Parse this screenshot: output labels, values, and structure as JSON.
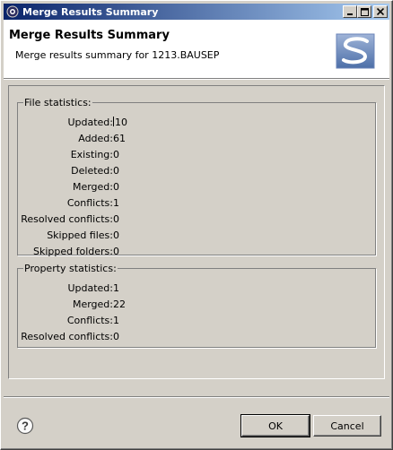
{
  "window": {
    "title": "Merge Results Summary",
    "controls": {
      "minimize": "_",
      "maximize": "□",
      "close": "✕"
    }
  },
  "header": {
    "title": "Merge Results Summary",
    "message": "Merge results summary for 1213.BAUSEP",
    "logo_icon": "subversion-logo"
  },
  "file_statistics": {
    "legend": "File statistics:",
    "rows": [
      {
        "label": "Updated:",
        "value": "10"
      },
      {
        "label": "Added:",
        "value": "61"
      },
      {
        "label": "Existing:",
        "value": "0"
      },
      {
        "label": "Deleted:",
        "value": "0"
      },
      {
        "label": "Merged:",
        "value": "0"
      },
      {
        "label": "Conflicts:",
        "value": "1"
      },
      {
        "label": "Resolved conflicts:",
        "value": "0"
      },
      {
        "label": "Skipped files:",
        "value": "0"
      },
      {
        "label": "Skipped folders:",
        "value": "0"
      }
    ]
  },
  "property_statistics": {
    "legend": "Property statistics:",
    "rows": [
      {
        "label": "Updated:",
        "value": "1"
      },
      {
        "label": "Merged:",
        "value": "22"
      },
      {
        "label": "Conflicts:",
        "value": "1"
      },
      {
        "label": "Resolved conflicts:",
        "value": "0"
      }
    ]
  },
  "buttons": {
    "ok": "OK",
    "cancel": "Cancel",
    "help_icon": "help-icon"
  },
  "colors": {
    "titlebar_start": "#0a246a",
    "titlebar_end": "#a6caf0",
    "face": "#d4d0c8"
  }
}
